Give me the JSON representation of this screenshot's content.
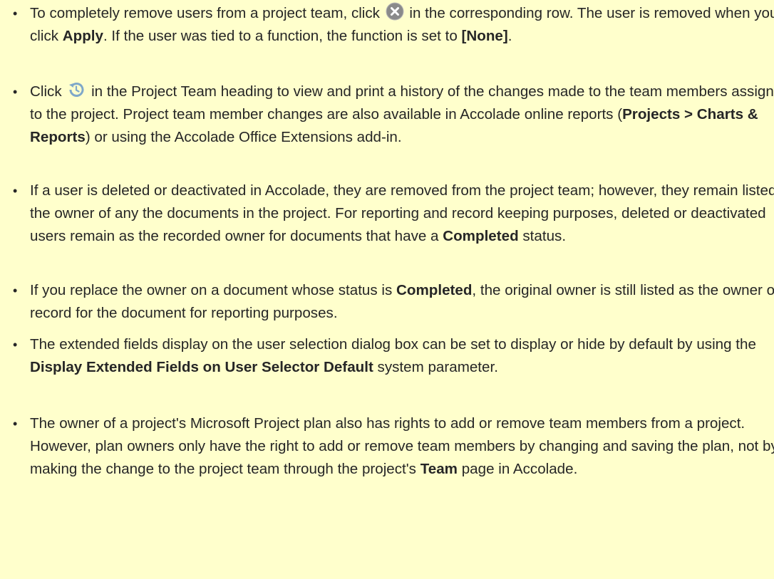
{
  "bullet_char": "•",
  "items": [
    {
      "p1": "To completely remove users from a project team, click ",
      "icon": "remove-circle-icon",
      "p2": " in the corresponding row. The user is removed when you click ",
      "b1": "Apply",
      "p3": ". If the user was tied to a function, the function is set to ",
      "b2": "[None]",
      "p4": "."
    },
    {
      "p1": "Click ",
      "icon": "history-icon",
      "p2": " in the Project Team heading to view and print a history of the changes made to the team members assigned to the project. Project team member changes are also available in Accolade online reports (",
      "b1": "Projects > Charts & Reports",
      "p3": ") or using the Accolade Office Extensions add-in."
    },
    {
      "p1": "If a user is deleted or deactivated in Accolade, they are removed from the project team; however, they remain listed as the owner of any the documents in the project. For reporting and record keeping purposes, deleted or deactivated users remain as the recorded owner for documents that have a ",
      "b1": "Completed",
      "p2": " status."
    },
    {
      "p1": "If you replace the owner on a document whose status is ",
      "b1": "Completed",
      "p2": ", the original owner is still listed as the owner of record for the document for reporting purposes."
    },
    {
      "p1": "The extended fields display on the user selection dialog box can be set to display or hide by default by using the ",
      "b1": "Display Extended Fields on User Selector Default",
      "p2": " system parameter."
    },
    {
      "p1": "The owner of a project's Microsoft Project plan also has rights to add or remove team members from a project. However, plan owners only have the right to add or remove team members by changing and saving the plan, not by making the change to the project team through the project's ",
      "b1": "Team",
      "p2": " page in Accolade."
    }
  ],
  "colors": {
    "background": "#FFFFCC",
    "text": "#262626",
    "icon_gray": "#8A8A8A",
    "icon_blue": "#7FA8C9"
  }
}
